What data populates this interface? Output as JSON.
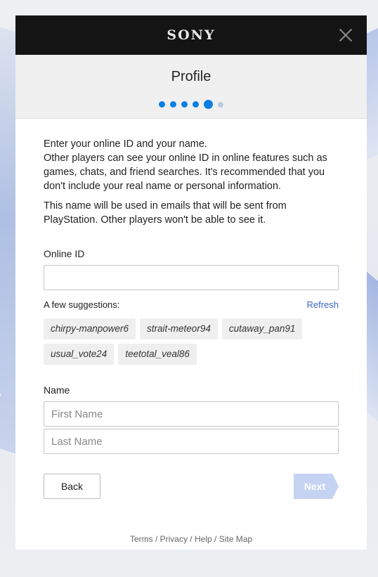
{
  "brand": {
    "logo": "SONY"
  },
  "header": {
    "title": "Profile",
    "progress": {
      "total_steps": 6,
      "current_step": 5
    }
  },
  "intro": {
    "paragraph1_line1": "Enter your online ID and your name.",
    "paragraph1_line2": "Other players can see your online ID in online features such as games, chats, and friend searches. It's recommended that you don't include your real name or personal information.",
    "paragraph2": "This name will be used in emails that will be sent from PlayStation. Other players won't be able to see it."
  },
  "online_id": {
    "label": "Online ID",
    "value": "",
    "suggestions_label": "A few suggestions:",
    "refresh_label": "Refresh",
    "suggestions": [
      "chirpy-manpower6",
      "strait-meteor94",
      "cutaway_pan91",
      "usual_vote24",
      "teetotal_veal86"
    ]
  },
  "name": {
    "label": "Name",
    "first_placeholder": "First Name",
    "last_placeholder": "Last Name"
  },
  "buttons": {
    "back": "Back",
    "next": "Next"
  },
  "footer": {
    "links": [
      "Terms",
      "Privacy",
      "Help",
      "Site Map"
    ],
    "separator": " / "
  },
  "colors": {
    "accent": "#0b7fe0",
    "link": "#3a66c8",
    "next_disabled": "#c5d3f2",
    "topbar": "#141414"
  }
}
